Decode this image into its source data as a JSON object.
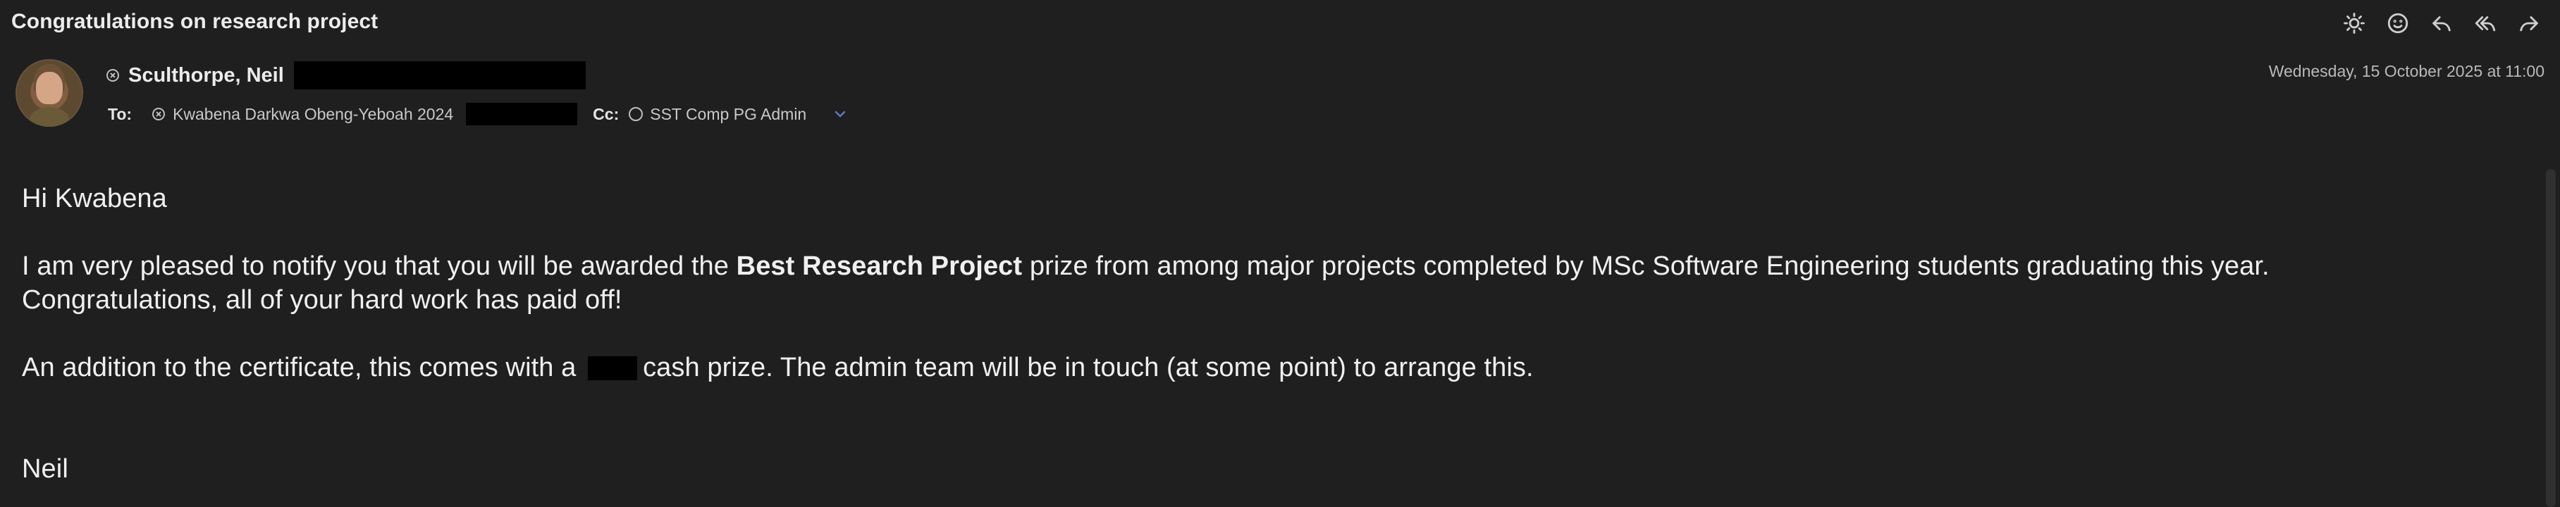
{
  "mail": {
    "subject": "Congratulations on research project",
    "sender": {
      "name": "Sculthorpe, Neil",
      "separator": "‹",
      "date": "Wednesday, 15 October 2025 at 11:00"
    },
    "recipients": {
      "to_label": "To:",
      "to_name": "Kwabena Darkwa Obeng-Yeboah 2024",
      "cc_label": "Cc:",
      "cc_name": "SST Comp PG Admin"
    },
    "body": {
      "greeting": "Hi Kwabena",
      "p1_before": "I am very pleased to notify you that you will be awarded the ",
      "p1_bold": "Best Research Project",
      "p1_after": " prize from among major projects completed by MSc Software Engineering students graduating this year.",
      "p2": "Congratulations, all of your hard work has paid off!",
      "p3_before": "An addition to the certificate, this comes with a ",
      "p3_after": "cash prize.  The admin team will be in touch (at some point) to arrange this.",
      "signature": "Neil"
    }
  },
  "toolbar": {
    "items": [
      {
        "name": "brightness-icon",
        "label": "Appearance"
      },
      {
        "name": "emoji-icon",
        "label": "React"
      },
      {
        "name": "reply-icon",
        "label": "Reply"
      },
      {
        "name": "reply-all-icon",
        "label": "Reply All"
      },
      {
        "name": "forward-icon",
        "label": "Forward"
      }
    ]
  },
  "colors": {
    "background": "#1f1f1f",
    "text": "#f0f0f0",
    "muted": "#b9b9b9",
    "redaction": "#000000",
    "accent": "#5f78bf"
  }
}
